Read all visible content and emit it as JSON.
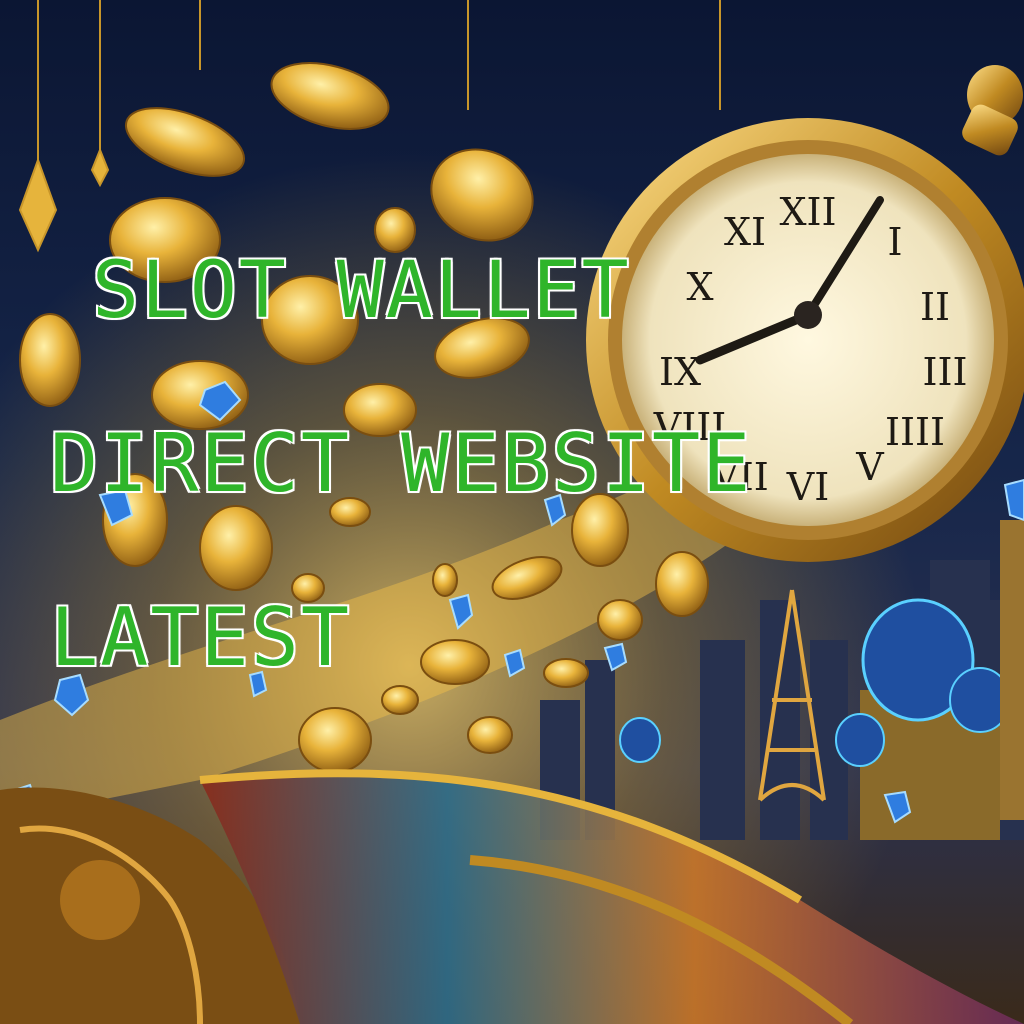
{
  "headline": {
    "line1": "SLOT WALLET",
    "line2": "DIRECT WEBSITE",
    "line3": "LATEST"
  },
  "colors": {
    "text_green": "#2fb52a",
    "text_outline": "#ffffff",
    "sky_top": "#0b1530",
    "gold": "#d9a52b",
    "diamond_blue": "#2f7de0"
  },
  "illustration": {
    "elements": [
      "pocket-watch-icon",
      "gold-coin-icon",
      "blue-diamond-icon",
      "eiffel-tower-icon",
      "domed-palace-icon",
      "hanging-lantern-icon",
      "carpet-track-icon"
    ],
    "clock_numerals": [
      "XII",
      "I",
      "II",
      "III",
      "IIII",
      "V",
      "VI",
      "VII",
      "VIII",
      "IX",
      "X",
      "XI"
    ]
  }
}
